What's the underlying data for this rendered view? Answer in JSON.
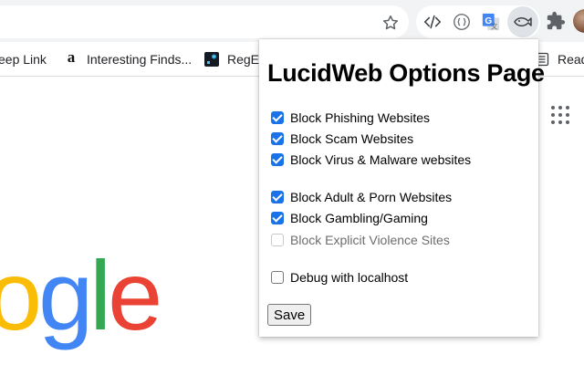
{
  "bookmarks": [
    {
      "label": "eep Link",
      "icon": "link-icon"
    },
    {
      "label": "Interesting Finds...",
      "icon": "amazon-icon",
      "icon_glyph": "a"
    },
    {
      "label": "RegEx",
      "icon": "regex-icon"
    },
    {
      "label": "Read",
      "icon": "reading-list-icon"
    }
  ],
  "extensions": [
    "code-extension-icon",
    "brackets-extension-icon",
    "google-translate-icon",
    "lucidweb-fish-icon"
  ],
  "page": {
    "logo_letters": [
      "o",
      "g",
      "l",
      "e"
    ],
    "logo_colors": [
      "#fbbc05",
      "#4285f4",
      "#34a853",
      "#ea4335"
    ]
  },
  "popup": {
    "title": "LucidWeb Options Page",
    "options": [
      {
        "label": "Block Phishing Websites",
        "checked": true,
        "enabled": true
      },
      {
        "label": "Block Scam Websites",
        "checked": true,
        "enabled": true
      },
      {
        "label": "Block Virus & Malware websites",
        "checked": true,
        "enabled": true
      },
      {
        "label": "Block Adult & Porn Websites",
        "checked": true,
        "enabled": true
      },
      {
        "label": "Block Gambling/Gaming",
        "checked": true,
        "enabled": true
      },
      {
        "label": "Block Explicit Violence Sites",
        "checked": false,
        "enabled": false
      },
      {
        "label": "Debug with localhost",
        "checked": false,
        "enabled": true
      }
    ],
    "save_label": "Save",
    "accent_color": "#1a73e8"
  }
}
